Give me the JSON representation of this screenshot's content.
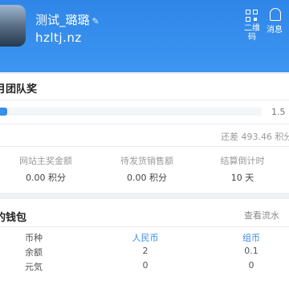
{
  "header": {
    "user_name": "测试_璐璐",
    "domain": "hzltj.nz",
    "qr_label": "二维码",
    "message_label": "消息"
  },
  "team_award": {
    "title": "月团队奖",
    "progress_value": "1.5",
    "progress_fraction": 0.04,
    "remaining": "还差 493.46 积分",
    "stats": [
      {
        "label": "网站主奖金额",
        "value": "0.00 积分"
      },
      {
        "label": "待发货销售额",
        "value": "0.00 积分"
      },
      {
        "label": "结算倒计时",
        "value": "10 天"
      }
    ]
  },
  "wallet": {
    "title": "的钱包",
    "flow_link": "查看流水",
    "headers": [
      "币种",
      "人民币",
      "组币"
    ],
    "rows": [
      [
        "余额",
        "2",
        "0.1"
      ],
      [
        "元気",
        "0",
        "0"
      ]
    ]
  },
  "colors": {
    "header_bg": "#3d95f1",
    "accent": "#3a8ee6"
  }
}
